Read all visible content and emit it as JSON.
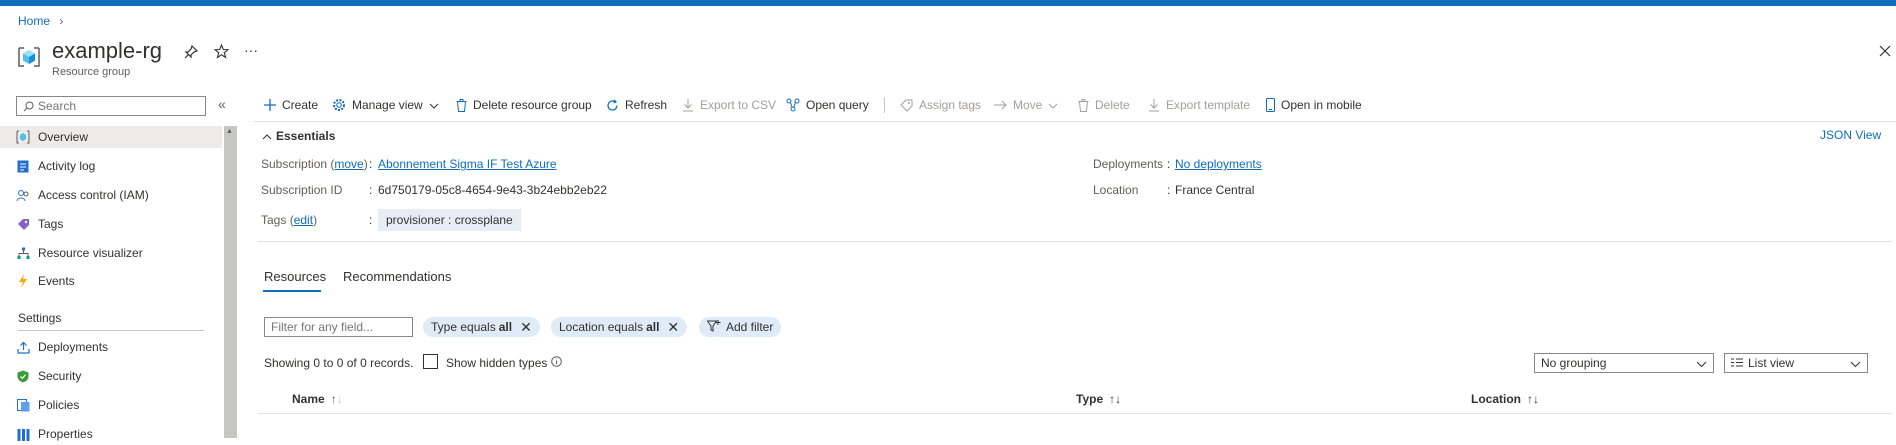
{
  "breadcrumb": {
    "home": "Home"
  },
  "header": {
    "title": "example-rg",
    "subtitle": "Resource group"
  },
  "sidebar": {
    "search_placeholder": "Search",
    "items": [
      {
        "label": "Overview"
      },
      {
        "label": "Activity log"
      },
      {
        "label": "Access control (IAM)"
      },
      {
        "label": "Tags"
      },
      {
        "label": "Resource visualizer"
      },
      {
        "label": "Events"
      }
    ],
    "settings_heading": "Settings",
    "settings_items": [
      {
        "label": "Deployments"
      },
      {
        "label": "Security"
      },
      {
        "label": "Policies"
      },
      {
        "label": "Properties"
      }
    ]
  },
  "toolbar": {
    "create": "Create",
    "manage_view": "Manage view",
    "delete_rg": "Delete resource group",
    "refresh": "Refresh",
    "export_csv": "Export to CSV",
    "open_query": "Open query",
    "assign_tags": "Assign tags",
    "move": "Move",
    "delete": "Delete",
    "export_template": "Export template",
    "open_mobile": "Open in mobile"
  },
  "essentials": {
    "heading": "Essentials",
    "json_view": "JSON View",
    "subscription_label": "Subscription",
    "move_link": "move",
    "subscription_value": "Abonnement Sigma IF Test Azure",
    "subscription_id_label": "Subscription ID",
    "subscription_id_value": "6d750179-05c8-4654-9e43-3b24ebb2eb22",
    "tags_label": "Tags",
    "edit_link": "edit",
    "tag_value": "provisioner : crossplane",
    "deployments_label": "Deployments",
    "deployments_value": "No deployments",
    "location_label": "Location",
    "location_value": "France Central",
    "colon": ":"
  },
  "tabs": {
    "resources": "Resources",
    "recommendations": "Recommendations"
  },
  "filters": {
    "placeholder": "Filter for any field...",
    "type_prefix": "Type equals",
    "type_value": "all",
    "location_prefix": "Location equals",
    "location_value": "all",
    "add_filter": "Add filter"
  },
  "records": {
    "showing": "Showing 0 to 0 of 0 records.",
    "show_hidden": "Show hidden types"
  },
  "grouping": {
    "selected": "No grouping"
  },
  "view": {
    "selected": "List view"
  },
  "table": {
    "columns": [
      "Name",
      "Type",
      "Location"
    ]
  },
  "colors": {
    "accent": "#0f6cbd",
    "selected_bg": "#edebe9",
    "pill_bg": "#dfecf8"
  }
}
